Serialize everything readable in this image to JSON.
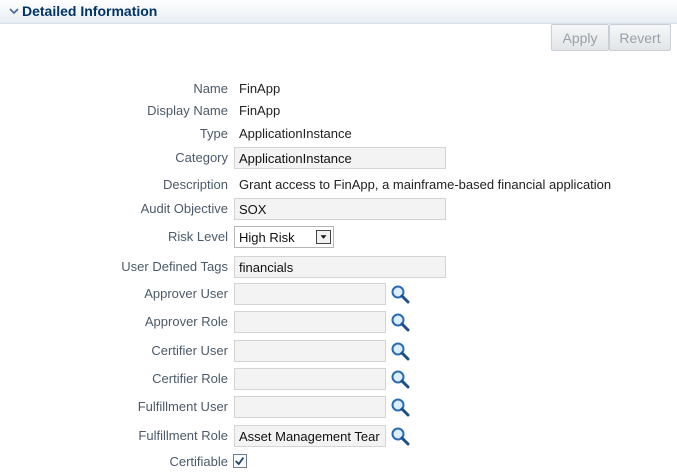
{
  "section": {
    "title": "Detailed Information",
    "disclosure_icon": "collapse-triangle-icon"
  },
  "toolbar": {
    "apply_label": "Apply",
    "revert_label": "Revert"
  },
  "form": {
    "name": {
      "label": "Name",
      "value": "FinApp"
    },
    "display_name": {
      "label": "Display Name",
      "value": "FinApp"
    },
    "type": {
      "label": "Type",
      "value": "ApplicationInstance"
    },
    "category": {
      "label": "Category",
      "value": "ApplicationInstance"
    },
    "description": {
      "label": "Description",
      "value": "Grant access to FinApp, a mainframe-based financial application"
    },
    "audit_objective": {
      "label": "Audit Objective",
      "value": "SOX"
    },
    "risk_level": {
      "label": "Risk Level",
      "value": "High Risk"
    },
    "user_defined_tags": {
      "label": "User Defined Tags",
      "value": "financials"
    },
    "approver_user": {
      "label": "Approver User",
      "value": ""
    },
    "approver_role": {
      "label": "Approver Role",
      "value": ""
    },
    "certifier_user": {
      "label": "Certifier User",
      "value": ""
    },
    "certifier_role": {
      "label": "Certifier Role",
      "value": ""
    },
    "fulfillment_user": {
      "label": "Fulfillment User",
      "value": ""
    },
    "fulfillment_role": {
      "label": "Fulfillment Role",
      "value": "Asset Management Tear"
    },
    "certifiable": {
      "label": "Certifiable",
      "checked": true
    }
  },
  "colors": {
    "label": "#4b5a6a",
    "title": "#003366",
    "field_bg": "#f3f3f3",
    "search_icon": "#2a6bb7"
  }
}
